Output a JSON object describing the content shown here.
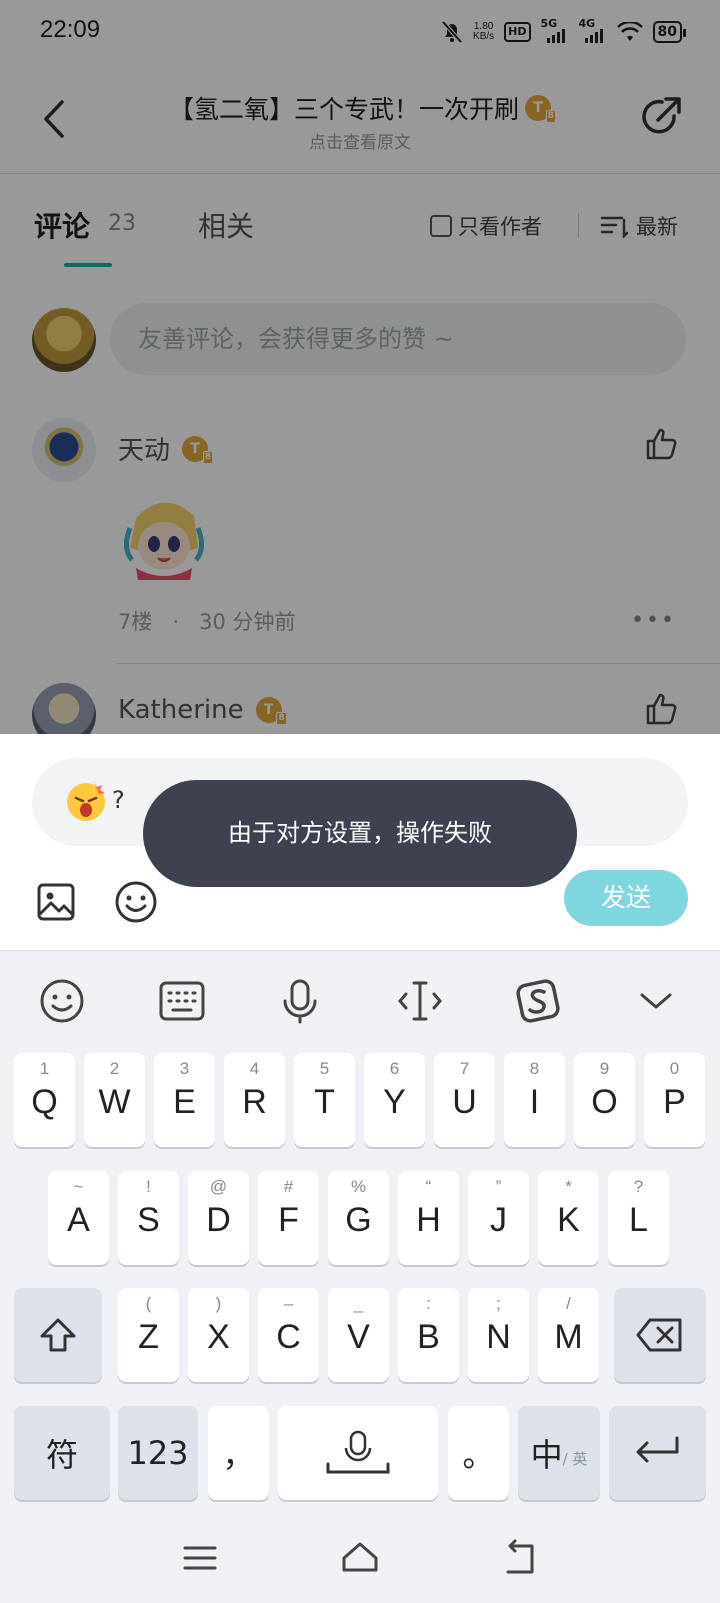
{
  "status_bar": {
    "time": "22:09",
    "speed_value": "1.80",
    "speed_unit": "KB/s",
    "hd_label": "HD",
    "net1": "5G",
    "net2": "4G",
    "battery": "80"
  },
  "header": {
    "title": "【氢二氧】三个专武！一次开刷",
    "subtitle": "点击查看原文",
    "badge_letter": "T"
  },
  "tabs": {
    "comments_label": "评论",
    "comments_count": "23",
    "related_label": "相关",
    "only_author_label": "只看作者",
    "sort_label": "最新"
  },
  "comment_input": {
    "placeholder": "友善评论，会获得更多的赞 ~"
  },
  "comments": [
    {
      "author": "天动",
      "badge": "T",
      "floor": "7楼",
      "time": "30 分钟前"
    },
    {
      "author": "Katherine",
      "badge": "T"
    }
  ],
  "reply": {
    "text": "?",
    "send_label": "发送"
  },
  "toast": {
    "message": "由于对方设置，操作失败"
  },
  "keyboard": {
    "row1": [
      {
        "sub": "1",
        "main": "Q"
      },
      {
        "sub": "2",
        "main": "W"
      },
      {
        "sub": "3",
        "main": "E"
      },
      {
        "sub": "4",
        "main": "R"
      },
      {
        "sub": "5",
        "main": "T"
      },
      {
        "sub": "6",
        "main": "Y"
      },
      {
        "sub": "7",
        "main": "U"
      },
      {
        "sub": "8",
        "main": "I"
      },
      {
        "sub": "9",
        "main": "O"
      },
      {
        "sub": "0",
        "main": "P"
      }
    ],
    "row2": [
      {
        "sub": "~",
        "main": "A"
      },
      {
        "sub": "!",
        "main": "S"
      },
      {
        "sub": "@",
        "main": "D"
      },
      {
        "sub": "#",
        "main": "F"
      },
      {
        "sub": "%",
        "main": "G"
      },
      {
        "sub": "“",
        "main": "H"
      },
      {
        "sub": "”",
        "main": "J"
      },
      {
        "sub": "*",
        "main": "K"
      },
      {
        "sub": "?",
        "main": "L"
      }
    ],
    "row3": [
      {
        "sub": "(",
        "main": "Z"
      },
      {
        "sub": ")",
        "main": "X"
      },
      {
        "sub": "–",
        "main": "C"
      },
      {
        "sub": "_",
        "main": "V"
      },
      {
        "sub": ":",
        "main": "B"
      },
      {
        "sub": ";",
        "main": "N"
      },
      {
        "sub": "/",
        "main": "M"
      }
    ],
    "symbols_label": "符",
    "numbers_label": "123",
    "comma_label": "，",
    "period_label": "。",
    "lang_main": "中",
    "lang_sub": "/ 英"
  }
}
